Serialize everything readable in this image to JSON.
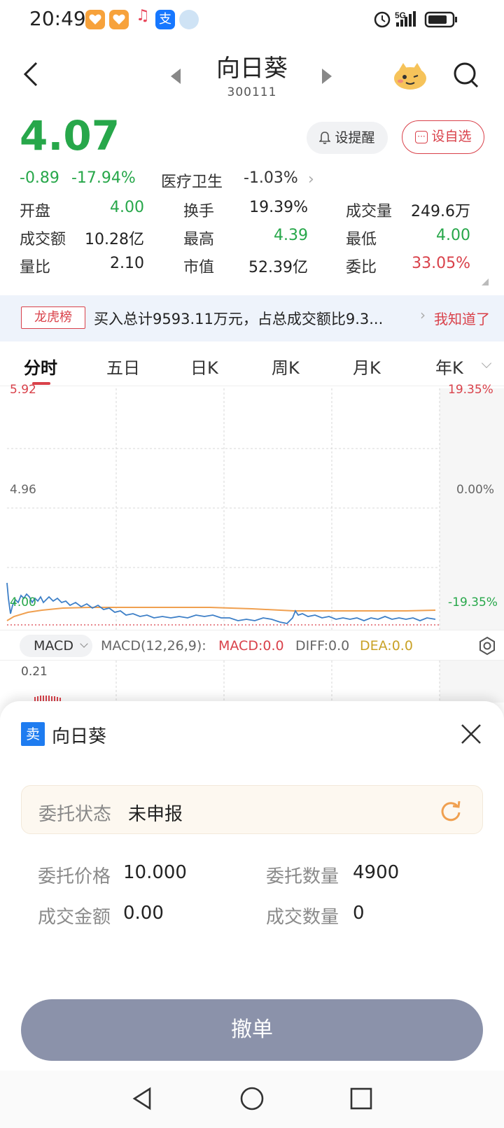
{
  "status_bar": {
    "time": "20:49",
    "network": "5G",
    "icons": [
      "heart-app-icon",
      "heart-app-icon",
      "music-icon",
      "alipay-icon",
      "cloud-app-icon",
      "alarm-icon",
      "signal-icon",
      "battery-icon"
    ]
  },
  "header": {
    "stock_name": "向日葵",
    "stock_code": "300111"
  },
  "quote": {
    "price": "4.07",
    "change": "-0.89",
    "change_pct": "-17.94%",
    "sector": "医疗卫生",
    "sector_change": "-1.03%",
    "alert_button": "设提醒",
    "watchlist_button": "设自选",
    "fields": [
      {
        "label": "开盘",
        "value": "4.00",
        "color": "green"
      },
      {
        "label": "换手",
        "value": "19.39%",
        "color": "black"
      },
      {
        "label": "成交量",
        "value": "249.6万",
        "color": "black"
      },
      {
        "label": "成交额",
        "value": "10.28亿",
        "color": "black"
      },
      {
        "label": "最高",
        "value": "4.39",
        "color": "green"
      },
      {
        "label": "最低",
        "value": "4.00",
        "color": "green"
      },
      {
        "label": "量比",
        "value": "2.10",
        "color": "black"
      },
      {
        "label": "市值",
        "value": "52.39亿",
        "color": "black"
      },
      {
        "label": "委比",
        "value": "33.05%",
        "color": "red"
      }
    ]
  },
  "banner": {
    "tag": "龙虎榜",
    "text": "买入总计9593.11万元，占总成交额比9.3...",
    "action": "我知道了"
  },
  "tabs": [
    "分时",
    "五日",
    "日K",
    "周K",
    "月K",
    "年K"
  ],
  "chart_axis": {
    "y_top": "5.92",
    "y_mid": "4.96",
    "y_bottom": "4.00",
    "pct_top": "19.35%",
    "pct_mid": "0.00%",
    "pct_bottom": "-19.35%"
  },
  "macd": {
    "selector": "MACD",
    "params": "MACD(12,26,9):",
    "macd": "MACD:0.0",
    "diff": "DIFF:0.0",
    "dea": "DEA:0.0",
    "scale_top": "0.21"
  },
  "order_sheet": {
    "side_badge": "卖",
    "title": "向日葵",
    "status_label": "委托状态",
    "status_value": "未申报",
    "price_label": "委托价格",
    "price_value": "10.000",
    "qty_label": "委托数量",
    "qty_value": "4900",
    "amount_label": "成交金额",
    "amount_value": "0.00",
    "filled_label": "成交数量",
    "filled_value": "0",
    "cancel_button": "撤单"
  },
  "colors": {
    "down_green": "#27a74a",
    "up_red": "#d9414a",
    "sell_blue": "#1e7cf0",
    "cancel_button_bg": "#8b92aa",
    "avg_line_orange": "#f0a050",
    "price_line_blue": "#3d7fc7"
  }
}
